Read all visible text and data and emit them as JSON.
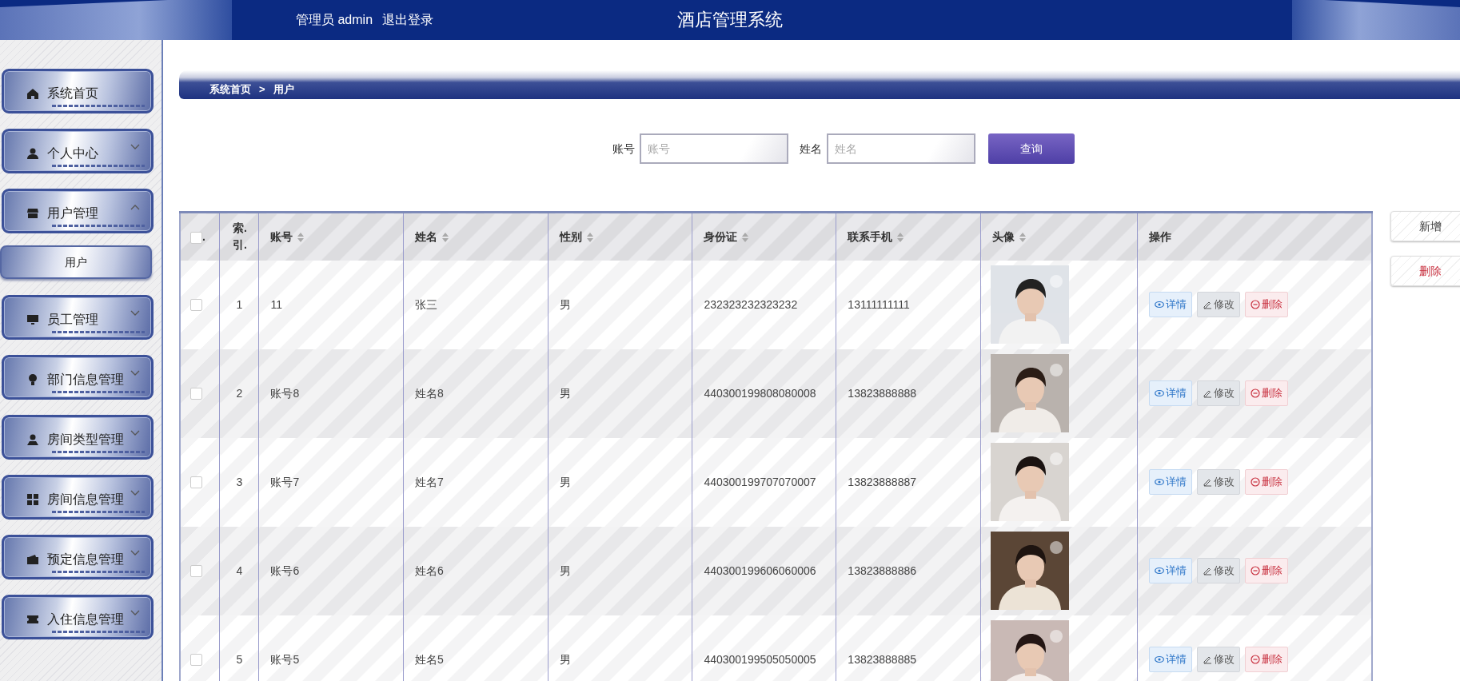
{
  "header": {
    "user_label": "管理员 admin",
    "logout": "退出登录",
    "title": "酒店管理系统"
  },
  "sidebar": {
    "items": [
      {
        "label": "系统首页",
        "kind": "link"
      },
      {
        "label": "个人中心",
        "kind": "menu",
        "expanded": false
      },
      {
        "label": "用户管理",
        "kind": "menu",
        "expanded": true,
        "children": [
          {
            "label": "用户",
            "selected": true
          }
        ]
      },
      {
        "label": "员工管理",
        "kind": "menu",
        "expanded": false
      },
      {
        "label": "部门信息管理",
        "kind": "menu",
        "expanded": false
      },
      {
        "label": "房间类型管理",
        "kind": "menu",
        "expanded": false
      },
      {
        "label": "房间信息管理",
        "kind": "menu",
        "expanded": false
      },
      {
        "label": "预定信息管理",
        "kind": "menu",
        "expanded": false
      },
      {
        "label": "入住信息管理",
        "kind": "menu",
        "expanded": false
      }
    ]
  },
  "breadcrumb": {
    "items": [
      "系统首页",
      "用户"
    ],
    "separator": ">"
  },
  "search": {
    "fields": [
      {
        "label": "账号",
        "placeholder": "账号"
      },
      {
        "label": "姓名",
        "placeholder": "姓名"
      }
    ],
    "button": "查询"
  },
  "table": {
    "select_all": {
      "checked": false,
      "label": "."
    },
    "columns": [
      {
        "label": "索.引.",
        "sortable": false
      },
      {
        "label": "账号",
        "sortable": true
      },
      {
        "label": "姓名",
        "sortable": true
      },
      {
        "label": "性别",
        "sortable": true
      },
      {
        "label": "身份证",
        "sortable": true
      },
      {
        "label": "联系手机",
        "sortable": true
      },
      {
        "label": "头像",
        "sortable": true
      },
      {
        "label": "操作",
        "sortable": false
      }
    ],
    "rows": [
      {
        "checked": false,
        "cells": [
          "1",
          "11",
          "张三",
          "男",
          "232323232323232",
          "13111111111"
        ],
        "actions": [
          {
            "label": "详情",
            "kind": "view"
          },
          {
            "label": "修改",
            "kind": "edit"
          },
          {
            "label": "删除",
            "kind": "delete"
          }
        ]
      },
      {
        "checked": false,
        "cells": [
          "2",
          "账号8",
          "姓名8",
          "男",
          "440300199808080008",
          "13823888888"
        ],
        "actions": [
          {
            "label": "详情",
            "kind": "view"
          },
          {
            "label": "修改",
            "kind": "edit"
          },
          {
            "label": "删除",
            "kind": "delete"
          }
        ]
      },
      {
        "checked": false,
        "cells": [
          "3",
          "账号7",
          "姓名7",
          "男",
          "440300199707070007",
          "13823888887"
        ],
        "actions": [
          {
            "label": "详情",
            "kind": "view"
          },
          {
            "label": "修改",
            "kind": "edit"
          },
          {
            "label": "删除",
            "kind": "delete"
          }
        ]
      },
      {
        "checked": false,
        "cells": [
          "4",
          "账号6",
          "姓名6",
          "男",
          "440300199606060006",
          "13823888886"
        ],
        "actions": [
          {
            "label": "详情",
            "kind": "view"
          },
          {
            "label": "修改",
            "kind": "edit"
          },
          {
            "label": "删除",
            "kind": "delete"
          }
        ]
      },
      {
        "checked": false,
        "cells": [
          "5",
          "账号5",
          "姓名5",
          "男",
          "440300199505050005",
          "13823888885"
        ],
        "actions": [
          {
            "label": "详情",
            "kind": "view"
          },
          {
            "label": "修改",
            "kind": "edit"
          },
          {
            "label": "删除",
            "kind": "delete"
          }
        ]
      }
    ]
  },
  "side_buttons": [
    {
      "label": "新增",
      "kind": "add"
    },
    {
      "label": "删除",
      "kind": "delete"
    }
  ]
}
